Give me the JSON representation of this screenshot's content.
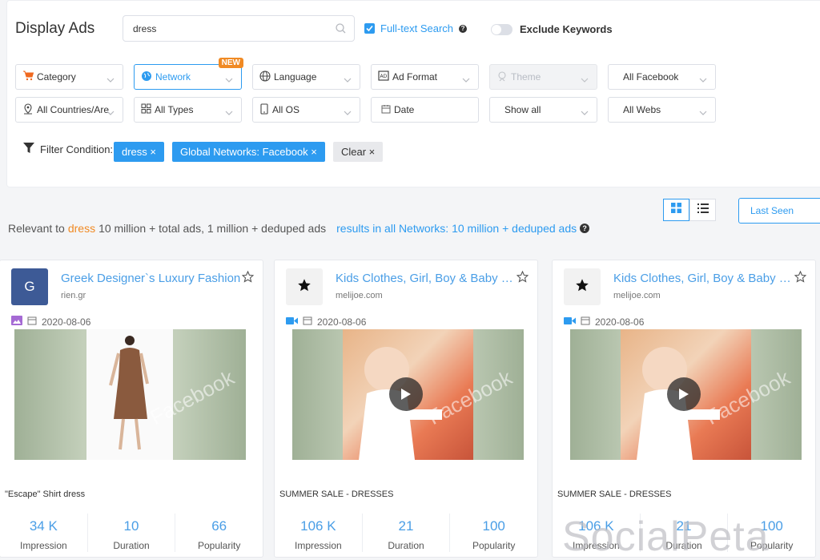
{
  "header": {
    "title": "Display Ads",
    "search_value": "dress",
    "fulltext_label": "Full-text Search",
    "exclude_label": "Exclude Keywords"
  },
  "filters": {
    "row1": [
      "Category",
      "Network",
      "Language",
      "Ad Format",
      "Theme",
      "All Facebook"
    ],
    "row2": [
      "All Countries/Are",
      "All Types",
      "All OS",
      "Date",
      "Show all",
      "All Webs"
    ],
    "new_badge": "NEW"
  },
  "condition": {
    "label": "Filter Condition:",
    "tags": [
      "dress ×",
      "Global Networks: Facebook ×"
    ],
    "clear": "Clear ×"
  },
  "toolbar": {
    "sort_label": "Last Seen"
  },
  "summary": {
    "prefix": "Relevant to",
    "keyword": "dress",
    "counts": "10 million + total ads, 1 million + deduped ads",
    "networks": "results in all Networks: 10 million + deduped ads"
  },
  "cards": [
    {
      "logo_text": "G",
      "name": "Greek Designer`s Luxury Fashion",
      "domain": "rien.gr",
      "date": "2020-08-06",
      "watermark": "Facebook",
      "caption": "\"Escape\" Shirt dress",
      "stats": [
        {
          "value": "34 K",
          "label": "Impression"
        },
        {
          "value": "10",
          "label": "Duration"
        },
        {
          "value": "66",
          "label": "Popularity"
        }
      ]
    },
    {
      "logo_text": "",
      "name": "Kids Clothes, Girl, Boy & Baby Clothing",
      "domain": "melijoe.com",
      "date": "2020-08-06",
      "watermark": "Facebook",
      "caption": "SUMMER SALE - DRESSES",
      "stats": [
        {
          "value": "106 K",
          "label": "Impression"
        },
        {
          "value": "21",
          "label": "Duration"
        },
        {
          "value": "100",
          "label": "Popularity"
        }
      ]
    },
    {
      "logo_text": "",
      "name": "Kids Clothes, Girl, Boy & Baby Clothing",
      "domain": "melijoe.com",
      "date": "2020-08-06",
      "watermark": "Facebook",
      "caption": "SUMMER SALE - DRESSES",
      "stats": [
        {
          "value": "106 K",
          "label": "Impression"
        },
        {
          "value": "21",
          "label": "Duration"
        },
        {
          "value": "100",
          "label": "Popularity"
        }
      ]
    }
  ],
  "brand": "SocialPeta",
  "colors": {
    "accent": "#2d9bf0",
    "orange": "#f08a24",
    "link": "#4a9ee6"
  }
}
